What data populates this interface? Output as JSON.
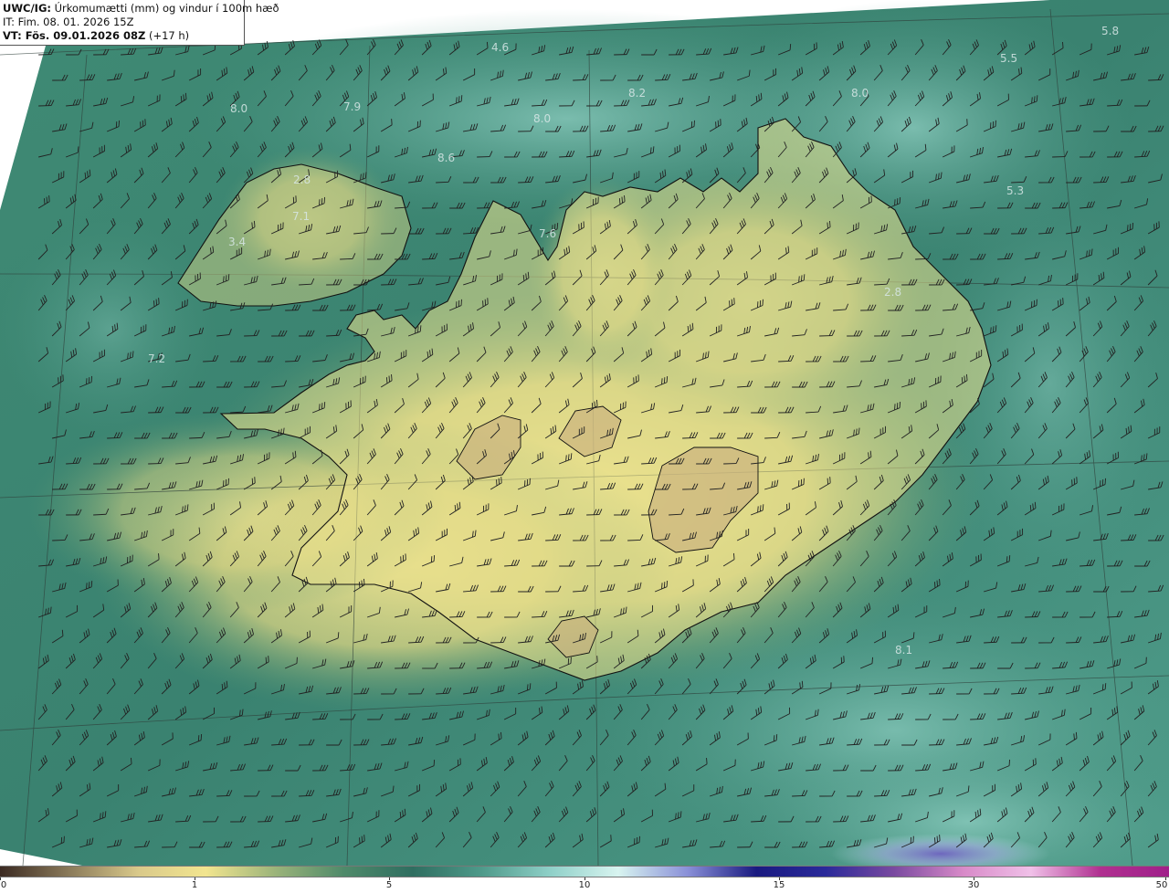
{
  "header": {
    "model_label": "UWC/IG:",
    "title": "Úrkomumætti (mm) og vindur í 100m hæð",
    "init_time": "IT: Fim. 08. 01. 2026 15Z",
    "valid_label": "VT: Fös. 09.01.2026 08Z",
    "valid_offset": "(+17 h)"
  },
  "field_labels": [
    {
      "text": "4.6"
    },
    {
      "text": "5.8"
    },
    {
      "text": "5.5"
    },
    {
      "text": "8.2"
    },
    {
      "text": "8.0"
    },
    {
      "text": "7.9"
    },
    {
      "text": "8.0"
    },
    {
      "text": "8.0"
    },
    {
      "text": "5.3"
    },
    {
      "text": "8.6"
    },
    {
      "text": "2.8"
    },
    {
      "text": "7.1"
    },
    {
      "text": "3.4"
    },
    {
      "text": "7.6"
    },
    {
      "text": "2.8"
    },
    {
      "text": "7.2"
    },
    {
      "text": "8.1"
    }
  ],
  "colorbar": {
    "ticks": [
      "0",
      "1",
      "5",
      "10",
      "15",
      "30",
      "50"
    ],
    "stops": [
      {
        "color": "#3b2a22"
      },
      {
        "color": "#8a7a5a"
      },
      {
        "color": "#d9c98a"
      },
      {
        "color": "#f2e58f"
      },
      {
        "color": "#9cb47a"
      },
      {
        "color": "#4f8a6a"
      },
      {
        "color": "#2f6e60"
      },
      {
        "color": "#4e9a8a"
      },
      {
        "color": "#8fd0c8"
      },
      {
        "color": "#d8f4f0"
      },
      {
        "color": "#8a90d8"
      },
      {
        "color": "#1a1a80"
      },
      {
        "color": "#2a2a9a"
      },
      {
        "color": "#7a4aa0"
      },
      {
        "color": "#d88ac8"
      },
      {
        "color": "#f0c0e8"
      },
      {
        "color": "#b03090"
      },
      {
        "color": "#a0208a"
      }
    ]
  },
  "colors": {
    "land_yellow": "#e8df8c",
    "sea_teal": "#3f8a72",
    "coastline": "#111111",
    "barb": "#222222"
  }
}
